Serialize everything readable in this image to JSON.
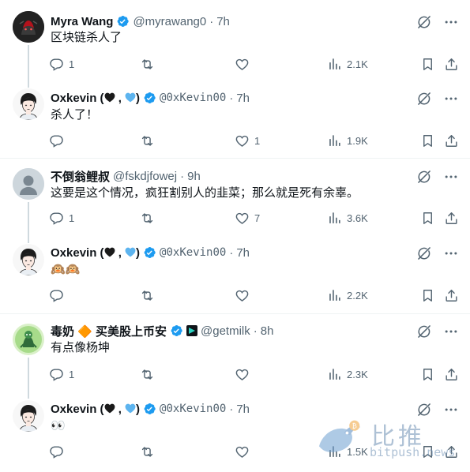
{
  "tweets": [
    {
      "name": "Myra Wang",
      "handle": "@myrawang0",
      "time": "7h",
      "text": "区块链杀人了",
      "stats": {
        "reply": "1",
        "retweet": "",
        "like": "",
        "views": "2.1K"
      }
    },
    {
      "name_prefix": "Oxkevin (",
      "name_sep": " , ",
      "name_suffix": ")",
      "handle": "@0xKevin00",
      "time": "7h",
      "text": "杀人了！",
      "stats": {
        "reply": "",
        "retweet": "",
        "like": "1",
        "views": "1.9K"
      }
    },
    {
      "name": "不倒翁鲤叔",
      "handle": "@fskdjfowej",
      "time": "9h",
      "text": "这要是这个情况，疯狂割别人的韭菜；那么就是死有余辜。",
      "stats": {
        "reply": "1",
        "retweet": "",
        "like": "7",
        "views": "3.6K"
      }
    },
    {
      "name_prefix": "Oxkevin (",
      "name_sep": " , ",
      "name_suffix": ")",
      "handle": "@0xKevin00",
      "time": "7h",
      "text": "🙉🙉",
      "stats": {
        "reply": "",
        "retweet": "",
        "like": "",
        "views": "2.2K"
      }
    },
    {
      "name": "毒奶 🔶 买美股上币安",
      "handle": "@getmilk",
      "time": "8h",
      "text": "有点像杨坤",
      "stats": {
        "reply": "1",
        "retweet": "",
        "like": "",
        "views": "2.3K"
      }
    },
    {
      "name_prefix": "Oxkevin (",
      "name_sep": " , ",
      "name_suffix": ")",
      "handle": "@0xKevin00",
      "time": "7h",
      "text": "👀",
      "stats": {
        "reply": "",
        "retweet": "",
        "like": "",
        "views": "1.5K"
      }
    }
  ],
  "dot": "·",
  "icons": {
    "top": [
      "grok-slash-icon",
      "more-icon"
    ],
    "actions": [
      "reply-icon",
      "retweet-icon",
      "like-icon",
      "views-icon",
      "bookmark-icon",
      "share-icon"
    ]
  },
  "watermark": {
    "brand": "比推",
    "domain": "bitpush.news"
  },
  "colors": {
    "verified_blue": "#1d9bf0",
    "muted": "#536471",
    "line": "#cfd9de",
    "divider": "#eff3f4"
  }
}
